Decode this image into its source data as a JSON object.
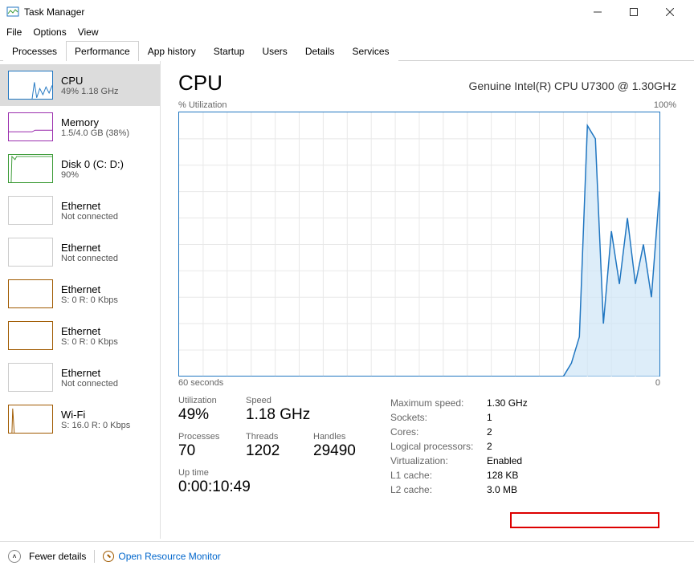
{
  "window": {
    "title": "Task Manager"
  },
  "menu": {
    "file": "File",
    "options": "Options",
    "view": "View"
  },
  "tabs": {
    "processes": "Processes",
    "performance": "Performance",
    "app_history": "App history",
    "startup": "Startup",
    "users": "Users",
    "details": "Details",
    "services": "Services"
  },
  "sidebar": [
    {
      "title": "CPU",
      "sub": "49% 1.18 GHz",
      "color": "#2076c1"
    },
    {
      "title": "Memory",
      "sub": "1.5/4.0 GB (38%)",
      "color": "#9b2fae"
    },
    {
      "title": "Disk 0 (C: D:)",
      "sub": "90%",
      "color": "#3a9a35"
    },
    {
      "title": "Ethernet",
      "sub": "Not connected",
      "color": "#bbbbbb"
    },
    {
      "title": "Ethernet",
      "sub": "Not connected",
      "color": "#bbbbbb"
    },
    {
      "title": "Ethernet",
      "sub": "S: 0 R: 0 Kbps",
      "color": "#a05a00"
    },
    {
      "title": "Ethernet",
      "sub": "S: 0 R: 0 Kbps",
      "color": "#a05a00"
    },
    {
      "title": "Ethernet",
      "sub": "Not connected",
      "color": "#bbbbbb"
    },
    {
      "title": "Wi-Fi",
      "sub": "S: 16.0 R: 0 Kbps",
      "color": "#a05a00"
    }
  ],
  "main": {
    "title": "CPU",
    "cpu_name": "Genuine Intel(R) CPU U7300 @ 1.30GHz",
    "util_label": "% Utilization",
    "util_max": "100%",
    "x_left": "60 seconds",
    "x_right": "0",
    "stats": {
      "utilization_label": "Utilization",
      "utilization_value": "49%",
      "speed_label": "Speed",
      "speed_value": "1.18 GHz",
      "processes_label": "Processes",
      "processes_value": "70",
      "threads_label": "Threads",
      "threads_value": "1202",
      "handles_label": "Handles",
      "handles_value": "29490",
      "uptime_label": "Up time",
      "uptime_value": "0:00:10:49"
    },
    "right": [
      {
        "k": "Maximum speed:",
        "v": "1.30 GHz"
      },
      {
        "k": "Sockets:",
        "v": "1"
      },
      {
        "k": "Cores:",
        "v": "2"
      },
      {
        "k": "Logical processors:",
        "v": "2"
      },
      {
        "k": "Virtualization:",
        "v": "Enabled"
      },
      {
        "k": "L1 cache:",
        "v": "128 KB"
      },
      {
        "k": "L2 cache:",
        "v": "3.0 MB"
      }
    ]
  },
  "footer": {
    "fewer": "Fewer details",
    "resource_monitor": "Open Resource Monitor"
  },
  "chart_data": {
    "type": "line",
    "title": "% Utilization",
    "xlabel": "60 seconds → 0",
    "ylabel": "% Utilization",
    "ylim": [
      0,
      100
    ],
    "x": [
      60,
      59,
      58,
      57,
      56,
      55,
      54,
      53,
      52,
      51,
      50,
      49,
      48,
      47,
      46,
      45,
      44,
      43,
      42,
      41,
      40,
      39,
      38,
      37,
      36,
      35,
      34,
      33,
      32,
      31,
      30,
      29,
      28,
      27,
      26,
      25,
      24,
      23,
      22,
      21,
      20,
      19,
      18,
      17,
      16,
      15,
      14,
      13,
      12,
      11,
      10,
      9,
      8,
      7,
      6,
      5,
      4,
      3,
      2,
      1,
      0
    ],
    "values": [
      0,
      0,
      0,
      0,
      0,
      0,
      0,
      0,
      0,
      0,
      0,
      0,
      0,
      0,
      0,
      0,
      0,
      0,
      0,
      0,
      0,
      0,
      0,
      0,
      0,
      0,
      0,
      0,
      0,
      0,
      0,
      0,
      0,
      0,
      0,
      0,
      0,
      0,
      0,
      0,
      0,
      0,
      0,
      0,
      0,
      0,
      0,
      0,
      0,
      5,
      15,
      95,
      90,
      20,
      55,
      35,
      60,
      35,
      50,
      30,
      70
    ]
  }
}
